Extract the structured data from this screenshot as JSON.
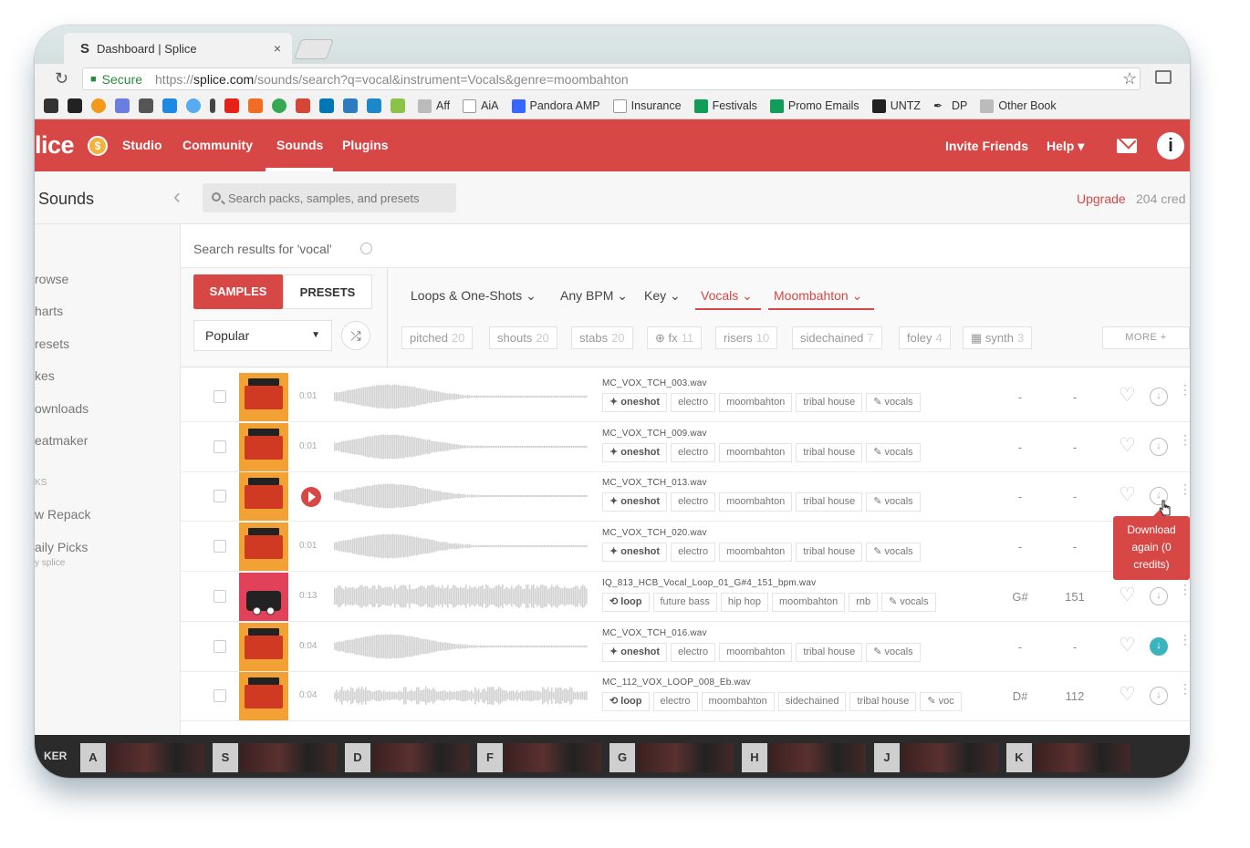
{
  "browser": {
    "tab_title": "Dashboard | Splice",
    "tab_icon": "S",
    "close_glyph": "×",
    "secure_label": "Secure",
    "url_scheme": "https://",
    "url_host": "splice.com",
    "url_path": "/sounds/search?q=vocal&instrument=Vocals&genre=moombahton",
    "bookmarks": [
      "Aff",
      "AiA",
      "Pandora AMP",
      "Insurance",
      "Festivals",
      "Promo Emails",
      "UNTZ",
      "DP",
      "Other Book"
    ]
  },
  "nav": {
    "logo": "lice",
    "links": [
      "Studio",
      "Community",
      "Sounds",
      "Plugins"
    ],
    "invite": "Invite Friends",
    "help": "Help ▾",
    "accent": "#d74746"
  },
  "subheader": {
    "title": "Sounds",
    "search_placeholder": "Search packs, samples, and presets",
    "upgrade": "Upgrade",
    "credits": "204 cred"
  },
  "sidebar": {
    "items": [
      "rowse",
      "harts",
      "resets",
      "kes",
      "ownloads",
      "eatmaker",
      "KS",
      "w Repack",
      "aily Picks",
      "y splice"
    ]
  },
  "main": {
    "results_label": "Search results for 'vocal'",
    "tabs": [
      "SAMPLES",
      "PRESETS"
    ],
    "sort": "Popular",
    "filters": [
      "Loops & One-Shots",
      "Any BPM",
      "Key",
      "Vocals",
      "Moombahton"
    ],
    "tag_pills": [
      {
        "label": "pitched",
        "count": "20"
      },
      {
        "label": "shouts",
        "count": "20"
      },
      {
        "label": "stabs",
        "count": "20"
      },
      {
        "label": "⊕ fx",
        "count": "11"
      },
      {
        "label": "risers",
        "count": "10"
      },
      {
        "label": "sidechained",
        "count": "7"
      },
      {
        "label": "foley",
        "count": "4"
      },
      {
        "label": "▦ synth",
        "count": "3"
      }
    ],
    "more_label": "MORE +"
  },
  "rows": [
    {
      "art": "orange",
      "dur": "0:01",
      "file": "MC_VOX_TCH_003.wav",
      "tags": [
        "✦ oneshot",
        "electro",
        "moombahton",
        "tribal house",
        "✎ vocals"
      ],
      "key": "-",
      "bpm": "-",
      "playing": false,
      "dl": "outline"
    },
    {
      "art": "orange",
      "dur": "0:01",
      "file": "MC_VOX_TCH_009.wav",
      "tags": [
        "✦ oneshot",
        "electro",
        "moombahton",
        "tribal house",
        "✎ vocals"
      ],
      "key": "-",
      "bpm": "-",
      "playing": false,
      "dl": "outline"
    },
    {
      "art": "orange",
      "dur": "",
      "file": "MC_VOX_TCH_013.wav",
      "tags": [
        "✦ oneshot",
        "electro",
        "moombahton",
        "tribal house",
        "✎ vocals"
      ],
      "key": "-",
      "bpm": "-",
      "playing": true,
      "dl": "outline"
    },
    {
      "art": "orange",
      "dur": "0:01",
      "file": "MC_VOX_TCH_020.wav",
      "tags": [
        "✦ oneshot",
        "electro",
        "moombahton",
        "tribal house",
        "✎ vocals"
      ],
      "key": "-",
      "bpm": "-",
      "playing": false,
      "dl": "outline"
    },
    {
      "art": "pink",
      "dur": "0:13",
      "file": "IQ_813_HCB_Vocal_Loop_01_G#4_151_bpm.wav",
      "tags": [
        "⟲ loop",
        "future bass",
        "hip hop",
        "moombahton",
        "rnb",
        "✎ vocals"
      ],
      "key": "G#",
      "bpm": "151",
      "playing": false,
      "dl": "outline"
    },
    {
      "art": "orange",
      "dur": "0:04",
      "file": "MC_VOX_TCH_016.wav",
      "tags": [
        "✦ oneshot",
        "electro",
        "moombahton",
        "tribal house",
        "✎ vocals"
      ],
      "key": "-",
      "bpm": "-",
      "playing": false,
      "dl": "filled"
    },
    {
      "art": "orange",
      "dur": "0:04",
      "file": "MC_112_VOX_LOOP_008_Eb.wav",
      "tags": [
        "⟲ loop",
        "electro",
        "moombahton",
        "sidechained",
        "tribal house",
        "✎ voc"
      ],
      "key": "D#",
      "bpm": "112",
      "playing": false,
      "dl": "outline"
    }
  ],
  "tooltip": "Download again (0 credits)",
  "dock": {
    "label": "KER",
    "keys": [
      "A",
      "S",
      "D",
      "F",
      "G",
      "H",
      "J",
      "K"
    ]
  }
}
